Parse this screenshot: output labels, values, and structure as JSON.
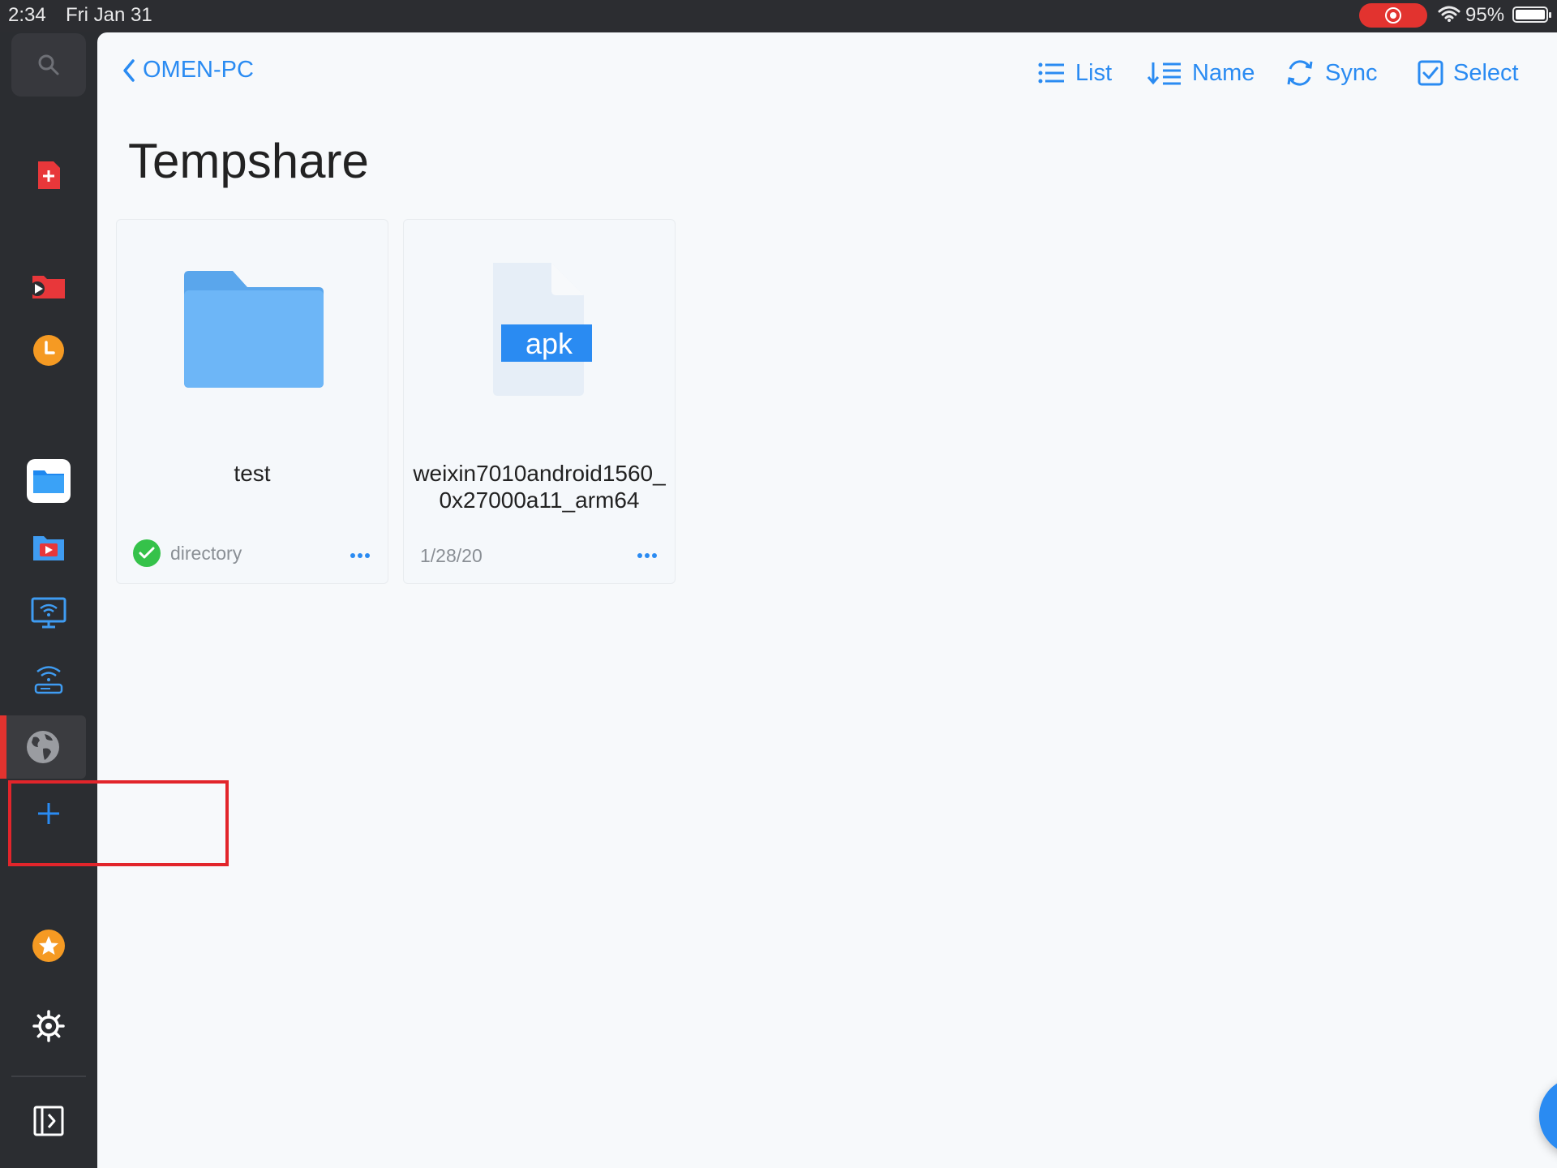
{
  "status_bar": {
    "time": "2:34",
    "date": "Fri Jan 31",
    "battery": "95%"
  },
  "sidebar": {
    "items": [
      {
        "icon": "search-icon"
      },
      {
        "icon": "pdf-plus-icon"
      },
      {
        "icon": "video-folder-icon"
      },
      {
        "icon": "recent-clock-icon"
      },
      {
        "icon": "files-folder-icon"
      },
      {
        "icon": "media-folder-icon"
      },
      {
        "icon": "monitor-wifi-icon"
      },
      {
        "icon": "wifi-transfer-icon"
      },
      {
        "icon": "network-globe-icon"
      },
      {
        "icon": "add-icon"
      },
      {
        "icon": "star-icon"
      },
      {
        "icon": "gear-icon"
      },
      {
        "icon": "sidebar-toggle-icon"
      }
    ]
  },
  "nav": {
    "back_label": "OMEN-PC"
  },
  "toolbar": {
    "list_label": "List",
    "sort_label": "Name",
    "sync_label": "Sync",
    "select_label": "Select"
  },
  "page": {
    "title": "Tempshare"
  },
  "files": [
    {
      "name": "test",
      "meta": "directory",
      "type": "folder"
    },
    {
      "name": "weixin7010android1560_0x27000a11_arm64",
      "meta": "1/28/20",
      "type": "apk",
      "badge": "apk"
    }
  ],
  "colors": {
    "accent": "#2a8bf2",
    "sidebar_bg": "#2b2d31",
    "highlight": "#e2252b"
  }
}
